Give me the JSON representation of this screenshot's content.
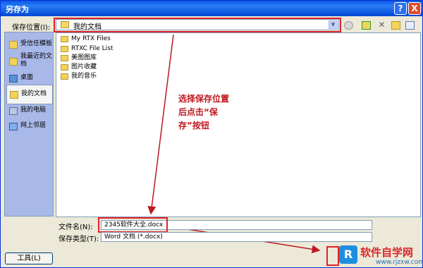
{
  "window": {
    "title": "另存为",
    "help": "?",
    "close": "X"
  },
  "location": {
    "label": "保存位置(I):",
    "value": "我的文档"
  },
  "places": [
    {
      "label": "受信任模板",
      "selected": false
    },
    {
      "label": "我最近的文档",
      "selected": false
    },
    {
      "label": "桌面",
      "selected": false
    },
    {
      "label": "我的文档",
      "selected": true
    },
    {
      "label": "我的电脑",
      "selected": false
    },
    {
      "label": "网上邻居",
      "selected": false
    }
  ],
  "files": [
    {
      "name": "My RTX Files"
    },
    {
      "name": "RTXC File List"
    },
    {
      "name": "美图图库"
    },
    {
      "name": "图片收藏"
    },
    {
      "name": "我的音乐"
    }
  ],
  "annotation": {
    "line1": "选择保存位置",
    "line2": "后点击“保",
    "line3": "存”按钮"
  },
  "filename": {
    "label": "文件名(N):",
    "value": "2345软件大全.docx"
  },
  "filetype": {
    "label": "保存类型(T):",
    "value": "Word 文档 (*.docx)"
  },
  "tools_button": "工具(L)",
  "watermark": {
    "logo": "R",
    "text": "软件自学网",
    "url": "www.rjzxw.com"
  },
  "colors": {
    "annotation": "#c0181e",
    "accent": "#0a5ae6"
  }
}
